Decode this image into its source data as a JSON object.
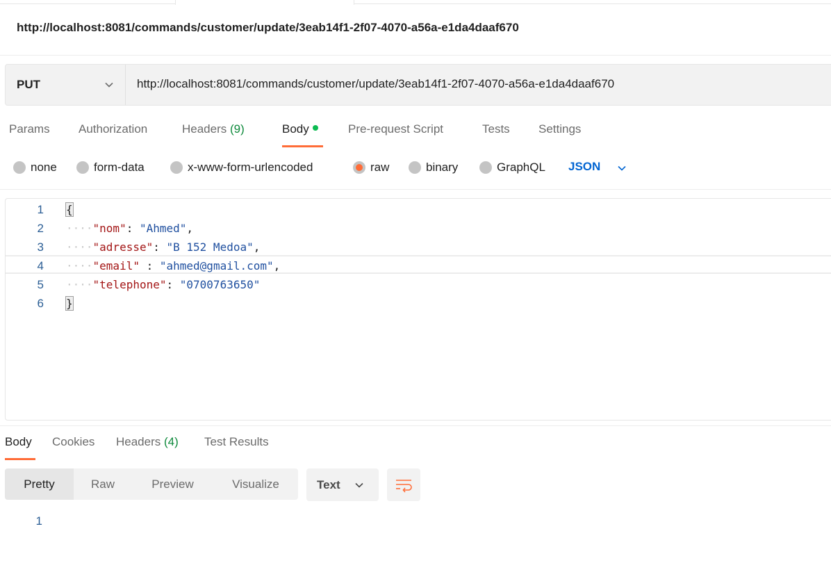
{
  "request": {
    "title": "http://localhost:8081/commands/customer/update/3eab14f1-2f07-4070-a56a-e1da4daaf670",
    "method": "PUT",
    "url": "http://localhost:8081/commands/customer/update/3eab14f1-2f07-4070-a56a-e1da4daaf670"
  },
  "request_tabs": {
    "params": "Params",
    "authorization": "Authorization",
    "headers": "Headers",
    "headers_count": "(9)",
    "body": "Body",
    "pre_request": "Pre-request Script",
    "tests": "Tests",
    "settings": "Settings",
    "active": "Body"
  },
  "body_types": {
    "none": "none",
    "form_data": "form-data",
    "urlencoded": "x-www-form-urlencoded",
    "raw": "raw",
    "binary": "binary",
    "graphql": "GraphQL",
    "selected": "raw",
    "language": "JSON"
  },
  "editor": {
    "line_numbers": [
      "1",
      "2",
      "3",
      "4",
      "5",
      "6"
    ],
    "open_brace": "{",
    "close_brace": "}",
    "lines": [
      {
        "key": "\"nom\"",
        "sep": ": ",
        "value": "\"Ahmed\"",
        "end": ","
      },
      {
        "key": "\"adresse\"",
        "sep": ": ",
        "value": "\"B 152 Medoa\"",
        "end": ","
      },
      {
        "key": "\"email\"",
        "sep": " : ",
        "value": "\"ahmed@gmail.com\"",
        "end": ","
      },
      {
        "key": "\"telephone\"",
        "sep": ": ",
        "value": "\"0700763650\"",
        "end": ""
      }
    ],
    "current_line": 4
  },
  "response_tabs": {
    "body": "Body",
    "cookies": "Cookies",
    "headers": "Headers",
    "headers_count": "(4)",
    "test_results": "Test Results",
    "active": "Body"
  },
  "response_view": {
    "pretty": "Pretty",
    "raw": "Raw",
    "preview": "Preview",
    "visualize": "Visualize",
    "active": "Pretty",
    "format": "Text",
    "line_number": "1"
  },
  "colors": {
    "accent": "#ff6c37",
    "count_green": "#0f8a3c",
    "dot_green": "#0cbb52",
    "json_blue": "#0265d2",
    "json_key": "#a31515",
    "json_string": "#1f4f9f"
  },
  "icons": {
    "method_dropdown": "chevron-down-icon",
    "language_dropdown": "chevron-down-icon",
    "format_dropdown": "chevron-down-icon",
    "wrap": "wrap-lines-icon"
  }
}
